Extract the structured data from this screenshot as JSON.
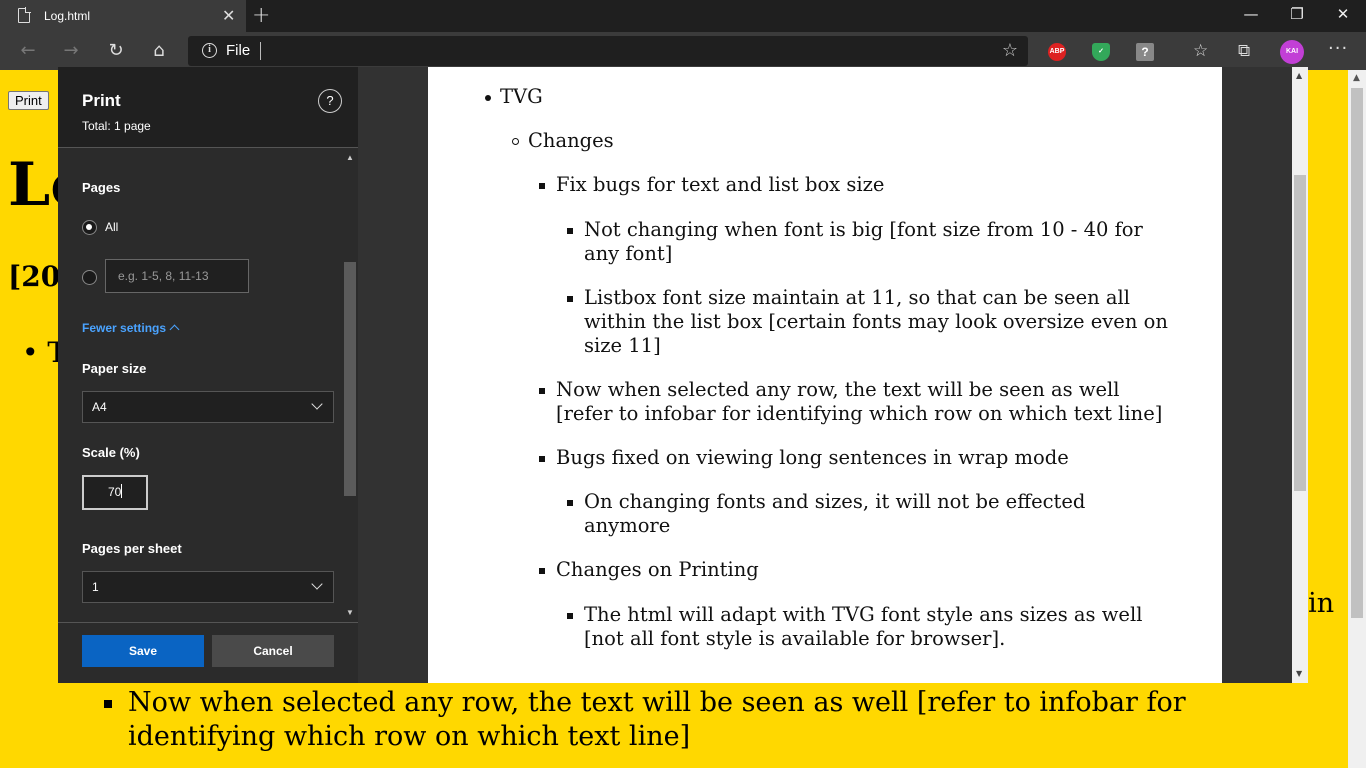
{
  "browser": {
    "tab_title": "Log.html",
    "tab_close": "✕",
    "new_tab": "+",
    "address_scheme": "File",
    "window_controls": [
      "—",
      "❐",
      "✕"
    ],
    "extensions": {
      "abp": "ABP",
      "question": "?"
    },
    "avatar_text": "KAI",
    "more": "···"
  },
  "background_page": {
    "print_button": "Print",
    "h1_fragment": "Lo",
    "h2_fragment": "[20",
    "bullet_fragment": "• T",
    "tail_fragment": "ain",
    "visible_item": "Now when selected any row, the text will be seen as well [refer to infobar for identifying which row on which text line]"
  },
  "print_dialog": {
    "title": "Print",
    "total": "Total: 1 page",
    "help": "?",
    "pages_label": "Pages",
    "all_label": "All",
    "range_placeholder": "e.g. 1-5, 8, 11-13",
    "fewer_settings": "Fewer settings",
    "paper_size_label": "Paper size",
    "paper_size_value": "A4",
    "scale_label": "Scale (%)",
    "scale_value": "70",
    "pages_per_sheet_label": "Pages per sheet",
    "pages_per_sheet_value": "1",
    "save": "Save",
    "cancel": "Cancel"
  },
  "preview": {
    "items": [
      {
        "level": 1,
        "text": "TVG"
      },
      {
        "level": 2,
        "text": "Changes"
      },
      {
        "level": 3,
        "text": "Fix bugs for text and list box size"
      },
      {
        "level": 4,
        "text": "Not changing when font is big [font size from 10 - 40 for any font]"
      },
      {
        "level": 4,
        "text": "Listbox font size maintain at 11, so that can be seen all within the list box [certain fonts may look oversize even on size 11]"
      },
      {
        "level": 3,
        "text": "Now when selected any row, the text will be seen as well [refer to infobar for identifying which row on which text line]"
      },
      {
        "level": 3,
        "text": "Bugs fixed on viewing long sentences in wrap mode"
      },
      {
        "level": 4,
        "text": "On changing fonts and sizes, it will not be effected anymore"
      },
      {
        "level": 3,
        "text": "Changes on Printing"
      },
      {
        "level": 4,
        "text": "The html will adapt with TVG font style ans sizes as well [not all font style is available for browser]."
      }
    ]
  },
  "colors": {
    "page_background": "#ffd800",
    "save_button": "#0a64c3",
    "link_blue": "#4aa3ff"
  }
}
